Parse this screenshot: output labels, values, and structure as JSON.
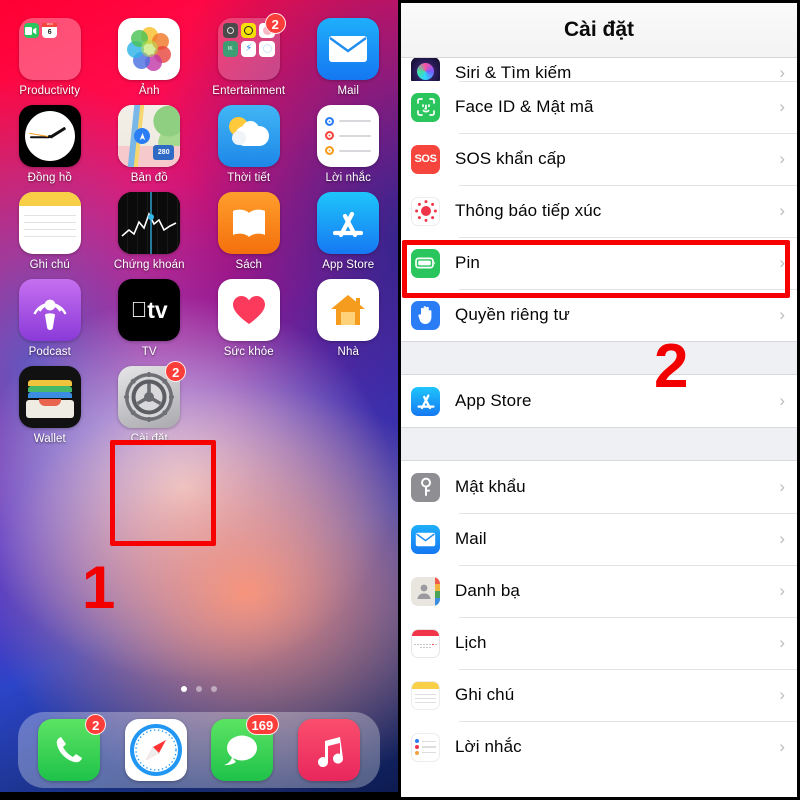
{
  "home": {
    "apps": [
      {
        "label": "Productivity",
        "icon": "productivity-folder-icon",
        "badge": null
      },
      {
        "label": "Ảnh",
        "icon": "photos-icon",
        "badge": null
      },
      {
        "label": "Entertainment",
        "icon": "entertainment-folder-icon",
        "badge": "2"
      },
      {
        "label": "Mail",
        "icon": "mail-icon",
        "badge": null
      },
      {
        "label": "Đồng hồ",
        "icon": "clock-icon",
        "badge": null
      },
      {
        "label": "Bản đồ",
        "icon": "maps-icon",
        "badge": null
      },
      {
        "label": "Thời tiết",
        "icon": "weather-icon",
        "badge": null
      },
      {
        "label": "Lời nhắc",
        "icon": "reminders-icon",
        "badge": null
      },
      {
        "label": "Ghi chú",
        "icon": "notes-icon",
        "badge": null
      },
      {
        "label": "Chứng khoán",
        "icon": "stocks-icon",
        "badge": null
      },
      {
        "label": "Sách",
        "icon": "books-icon",
        "badge": null
      },
      {
        "label": "App Store",
        "icon": "app-store-icon",
        "badge": null
      },
      {
        "label": "Podcast",
        "icon": "podcasts-icon",
        "badge": null
      },
      {
        "label": "TV",
        "icon": "tv-icon",
        "badge": null
      },
      {
        "label": "Sức khỏe",
        "icon": "health-icon",
        "badge": null
      },
      {
        "label": "Nhà",
        "icon": "home-app-icon",
        "badge": null
      },
      {
        "label": "Wallet",
        "icon": "wallet-icon",
        "badge": null
      },
      {
        "label": "Cài đặt",
        "icon": "settings-gear-icon",
        "badge": "2"
      }
    ],
    "dock": [
      {
        "label": "Điện thoại",
        "icon": "phone-icon",
        "badge": "2"
      },
      {
        "label": "Safari",
        "icon": "safari-compass-icon",
        "badge": null
      },
      {
        "label": "Tin nhắn",
        "icon": "messages-icon",
        "badge": "169"
      },
      {
        "label": "Nhạc",
        "icon": "music-note-icon",
        "badge": null
      }
    ],
    "page_dots": 3,
    "active_page": 0,
    "step_number": "1",
    "tv_icon_text": "tv",
    "maps_shield_text": "280"
  },
  "settings": {
    "nav_title": "Cài đặt",
    "groups": [
      {
        "items": [
          {
            "label": "Siri & Tìm kiếm",
            "icon": "siri-icon",
            "chevron": "›",
            "clipped": true
          },
          {
            "label": "Face ID & Mật mã",
            "icon": "face-id-icon",
            "chevron": "›"
          },
          {
            "label": "SOS khẩn cấp",
            "icon": "sos-icon",
            "chevron": "›",
            "icon_text": "SOS"
          },
          {
            "label": "Thông báo tiếp xúc",
            "icon": "exposure-notifications-icon",
            "chevron": "›"
          },
          {
            "label": "Pin",
            "icon": "battery-icon",
            "chevron": "›",
            "highlighted": true
          },
          {
            "label": "Quyền riêng tư",
            "icon": "privacy-hand-icon",
            "chevron": "›"
          }
        ]
      },
      {
        "items": [
          {
            "label": "App Store",
            "icon": "app-store-icon",
            "chevron": "›"
          }
        ]
      },
      {
        "items": [
          {
            "label": "Mật khẩu",
            "icon": "passwords-key-icon",
            "chevron": "›"
          },
          {
            "label": "Mail",
            "icon": "mail-icon",
            "chevron": "›"
          },
          {
            "label": "Danh bạ",
            "icon": "contacts-icon",
            "chevron": "›"
          },
          {
            "label": "Lịch",
            "icon": "calendar-icon",
            "chevron": "›"
          },
          {
            "label": "Ghi chú",
            "icon": "notes-icon",
            "chevron": "›"
          },
          {
            "label": "Lời nhắc",
            "icon": "reminders-icon",
            "chevron": "›"
          }
        ]
      }
    ],
    "step_number": "2"
  },
  "annotations": {
    "highlight_color": "#f60000",
    "step_color": "#f20000"
  }
}
